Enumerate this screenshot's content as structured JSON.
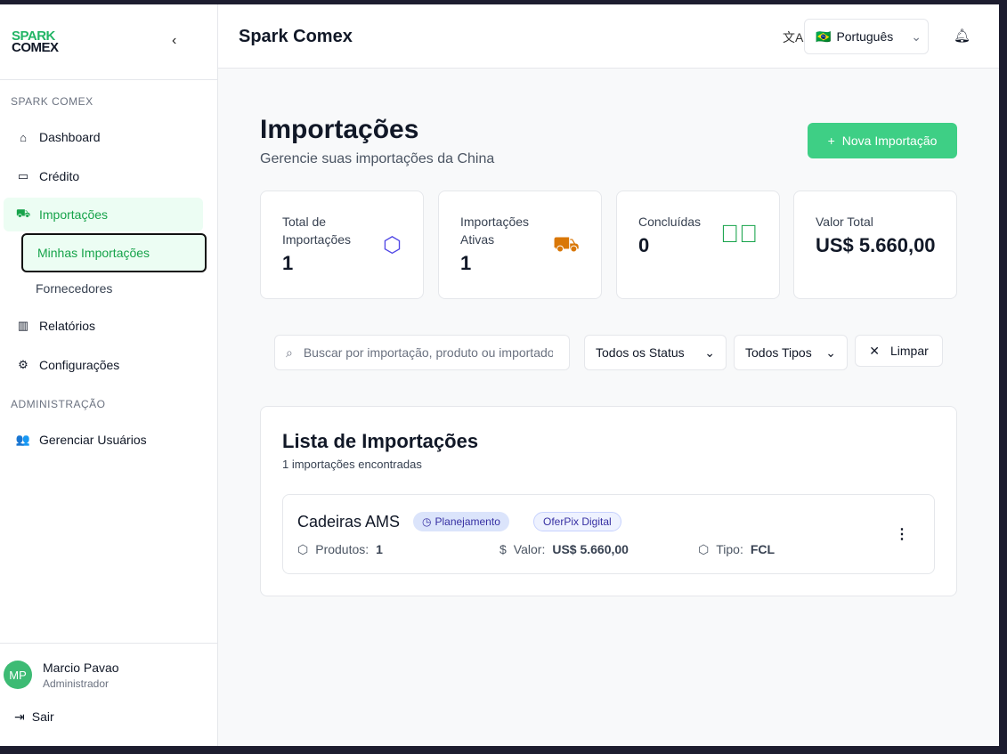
{
  "sidebar": {
    "logo_top": "SPARK",
    "logo_bottom": "COMEX",
    "section1": "SPARK COMEX",
    "items": [
      {
        "label": "Dashboard"
      },
      {
        "label": "Crédito"
      },
      {
        "label": "Importações"
      },
      {
        "label": "Relatórios"
      },
      {
        "label": "Configurações"
      }
    ],
    "subitems": [
      {
        "label": "Minhas Importações"
      },
      {
        "label": "Fornecedores"
      }
    ],
    "section2": "ADMINISTRAÇÃO",
    "admin_item": "Gerenciar Usuários",
    "user": {
      "initials": "MP",
      "name": "Marcio Pavao",
      "role": "Administrador"
    },
    "logout": "Sair"
  },
  "header": {
    "title": "Spark Comex",
    "language": "Português",
    "flag": "🇧🇷"
  },
  "page": {
    "title": "Importações",
    "subtitle": "Gerencie suas importações da China",
    "new_button": "Nova Importação"
  },
  "cards": [
    {
      "label": "Total de Importações",
      "value": "1"
    },
    {
      "label": "Importações Ativas",
      "value": "1"
    },
    {
      "label": "Concluídas",
      "value": "0"
    },
    {
      "label": "Valor Total",
      "value": "US$ 5.660,00"
    }
  ],
  "filters": {
    "search_placeholder": "Buscar por importação, produto ou importador",
    "status": "Todos os Status",
    "type": "Todos Tipos",
    "clear": "Limpar"
  },
  "list": {
    "title": "Lista de Importações",
    "count": "1 importações encontradas",
    "items": [
      {
        "name": "Cadeiras AMS",
        "status": "Planejamento",
        "supplier": "OferPix Digital",
        "products_label": "Produtos:",
        "products": "1",
        "value_label": "Valor:",
        "value": "US$ 5.660,00",
        "type_label": "Tipo:",
        "type": "FCL"
      }
    ]
  },
  "colors": {
    "accent": "#3ecf85",
    "active_bg": "#ecfdf3"
  }
}
